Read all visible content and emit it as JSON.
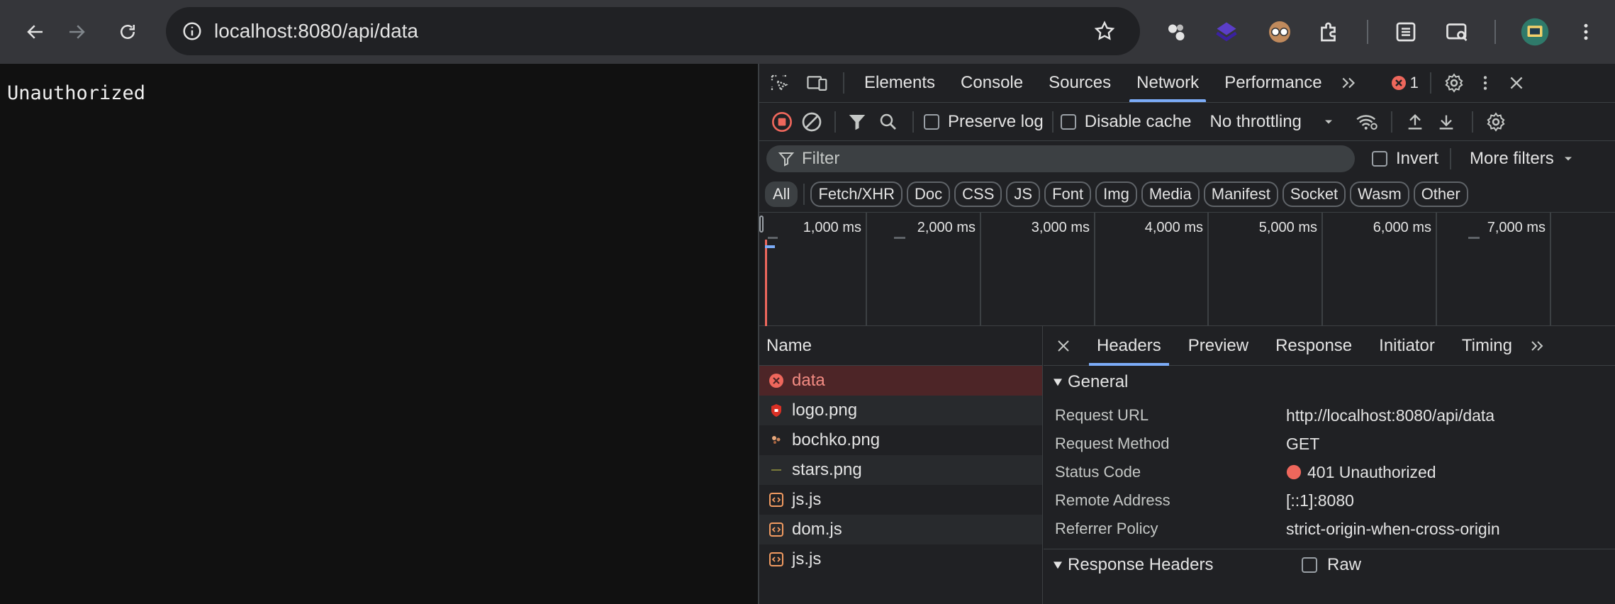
{
  "browser": {
    "url": "localhost:8080/api/data"
  },
  "page": {
    "text": "Unauthorized"
  },
  "devtools": {
    "tabs": [
      "Elements",
      "Console",
      "Sources",
      "Network",
      "Performance"
    ],
    "active_tab": "Network",
    "error_count": "1",
    "toolbar": {
      "preserve_log": "Preserve log",
      "disable_cache": "Disable cache",
      "throttling": "No throttling"
    },
    "filter": {
      "placeholder": "Filter",
      "invert": "Invert",
      "more_filters": "More filters"
    },
    "type_filters": [
      "All",
      "Fetch/XHR",
      "Doc",
      "CSS",
      "JS",
      "Font",
      "Img",
      "Media",
      "Manifest",
      "Socket",
      "Wasm",
      "Other"
    ],
    "timeline_ticks": [
      "1,000 ms",
      "2,000 ms",
      "3,000 ms",
      "4,000 ms",
      "5,000 ms",
      "6,000 ms",
      "7,000 ms"
    ],
    "list_header": "Name",
    "requests": [
      {
        "name": "data",
        "type": "error"
      },
      {
        "name": "logo.png",
        "type": "image"
      },
      {
        "name": "bochko.png",
        "type": "image"
      },
      {
        "name": "stars.png",
        "type": "image"
      },
      {
        "name": "js.js",
        "type": "script"
      },
      {
        "name": "dom.js",
        "type": "script"
      },
      {
        "name": "js.js",
        "type": "script"
      }
    ],
    "detail_tabs": [
      "Headers",
      "Preview",
      "Response",
      "Initiator",
      "Timing"
    ],
    "active_detail_tab": "Headers",
    "general": {
      "title": "General",
      "rows": [
        {
          "key": "Request URL",
          "value": "http://localhost:8080/api/data"
        },
        {
          "key": "Request Method",
          "value": "GET"
        },
        {
          "key": "Status Code",
          "value": "401 Unauthorized"
        },
        {
          "key": "Remote Address",
          "value": "[::1]:8080"
        },
        {
          "key": "Referrer Policy",
          "value": "strict-origin-when-cross-origin"
        }
      ]
    },
    "response_headers": {
      "title": "Response Headers",
      "raw": "Raw"
    },
    "colors": {
      "accent": "#7cacf8",
      "error": "#f28b82",
      "error_dot": "#ee675c"
    }
  }
}
